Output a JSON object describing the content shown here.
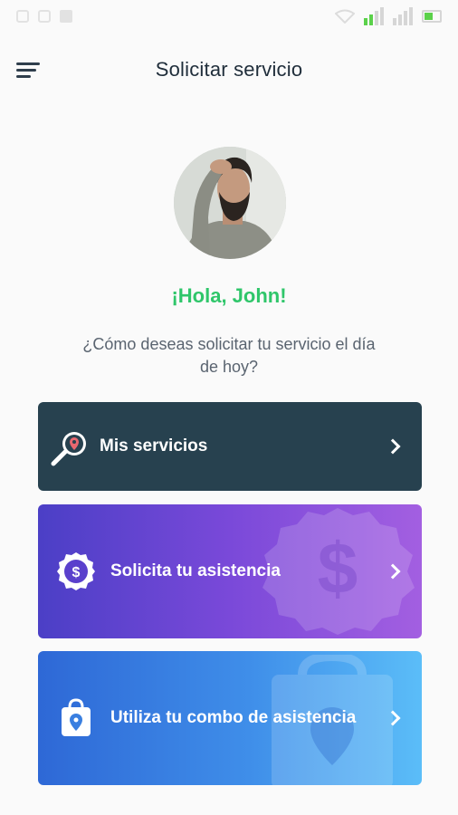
{
  "header": {
    "title": "Solicitar servicio"
  },
  "profile": {
    "greeting": "¡Hola, John!",
    "question": "¿Cómo deseas solicitar tu servicio el día de hoy?"
  },
  "cards": [
    {
      "label": "Mis servicios",
      "icon": "search-location-icon",
      "color": "#27414f"
    },
    {
      "label": "Solicita tu asistencia",
      "icon": "dollar-badge-icon",
      "color": "#7a49d9"
    },
    {
      "label": "Utiliza tu combo de asistencia",
      "icon": "shopping-bag-location-icon",
      "color": "#3f8ee9"
    }
  ],
  "colors": {
    "accent_green": "#2fc66a",
    "title_dark": "#1f2d3a",
    "card_dark": "#27414f"
  }
}
